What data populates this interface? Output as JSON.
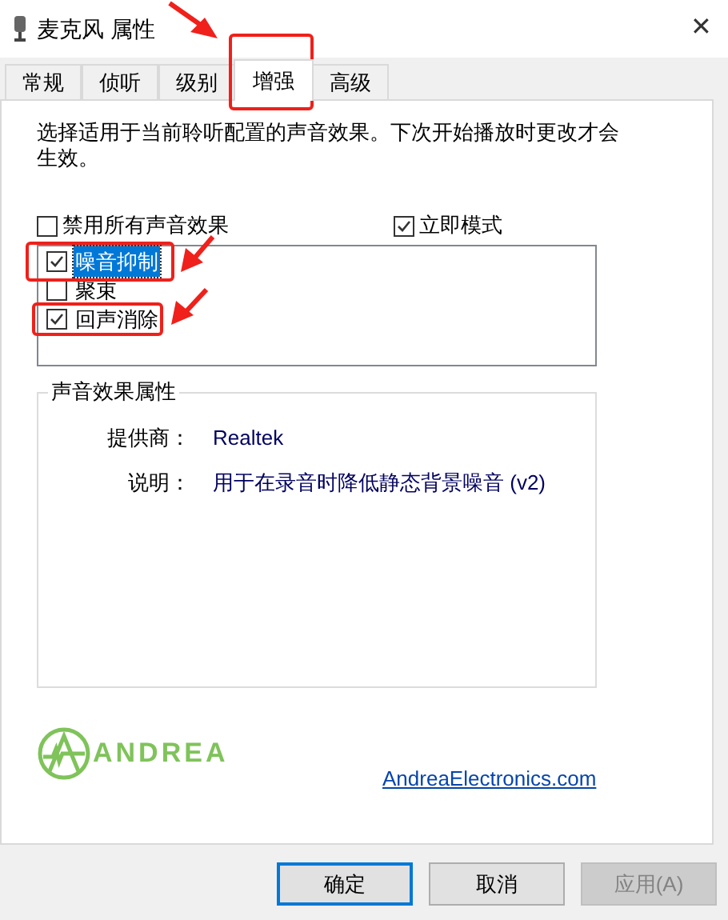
{
  "window": {
    "title": "麦克风 属性",
    "close": "✕"
  },
  "tabs": [
    {
      "label": "常规",
      "selected": false
    },
    {
      "label": "侦听",
      "selected": false
    },
    {
      "label": "级别",
      "selected": false
    },
    {
      "label": "增强",
      "selected": true
    },
    {
      "label": "高级",
      "selected": false
    }
  ],
  "description": "选择适用于当前聆听配置的声音效果。下次开始播放时更改才会生效。",
  "options": [
    {
      "label": "禁用所有声音效果",
      "checked": false
    },
    {
      "label": "立即模式",
      "checked": true
    }
  ],
  "effects": [
    {
      "label": "噪音抑制",
      "checked": true,
      "selected": true
    },
    {
      "label": "聚束",
      "checked": false,
      "selected": false
    },
    {
      "label": "回声消除",
      "checked": true,
      "selected": false
    }
  ],
  "properties": {
    "title": "声音效果属性",
    "rows": [
      {
        "label": "提供商：",
        "value": "Realtek"
      },
      {
        "label": "说明：",
        "value": "用于在录音时降低静态背景噪音 (v2)"
      }
    ]
  },
  "logo": {
    "text": "ANDREA"
  },
  "link": "AndreaElectronics.com",
  "buttons": [
    {
      "label": "确定",
      "default": true,
      "disabled": false
    },
    {
      "label": "取消",
      "default": false,
      "disabled": false
    },
    {
      "label": "应用(A)",
      "default": false,
      "disabled": true
    }
  ]
}
